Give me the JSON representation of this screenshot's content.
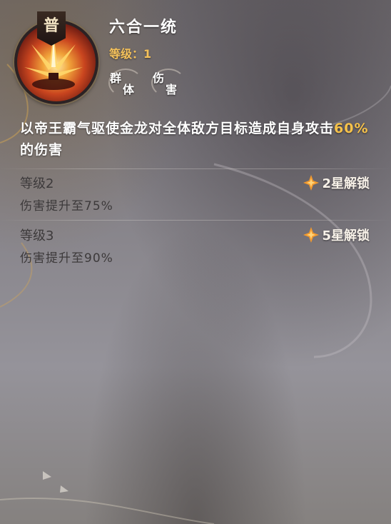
{
  "skill": {
    "icon_label": "普",
    "name": "六合一统",
    "level_label": "等级：",
    "level_value": "1",
    "tags": [
      {
        "c1": "群",
        "c2": "体"
      },
      {
        "c1": "伤",
        "c2": "害"
      }
    ],
    "description_before": "以帝王霸气驱使金龙对全体敌方目标造成自身攻击",
    "description_highlight": "60%",
    "description_after": "的伤害"
  },
  "upgrades": [
    {
      "title": "等级2",
      "desc": "伤害提升至75%",
      "unlock": "2星解锁"
    },
    {
      "title": "等级3",
      "desc": "伤害提升至90%",
      "unlock": "5星解锁"
    }
  ],
  "colors": {
    "level_accent": "#f4c15a",
    "highlight": "#f6c24a",
    "unlock_star": "#f29a2e"
  },
  "icons": {
    "skill": "golden-swords-burst-icon",
    "unlock": "four-point-star-icon"
  }
}
